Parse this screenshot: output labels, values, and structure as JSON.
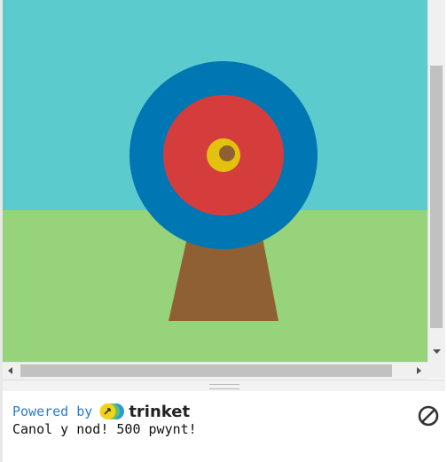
{
  "scene": {
    "sky_color": "#5ccbcd",
    "grass_color": "#97d37a",
    "stand_color": "#8f6033",
    "rings": [
      {
        "name": "outer-ring",
        "color": "#0077b3"
      },
      {
        "name": "middle-ring",
        "color": "#d53d3d"
      },
      {
        "name": "inner-ring",
        "color": "#e2c20f"
      },
      {
        "name": "bullseye",
        "color": "#8f6033"
      }
    ]
  },
  "scrollbars": {
    "vertical_down_icon": "arrow-down-icon",
    "horizontal_left_icon": "arrow-left-icon",
    "horizontal_right_icon": "arrow-right-icon"
  },
  "console": {
    "powered_by": "Powered by",
    "brand": "trinket",
    "output_line": "Canol y nod! 500 pwynt!",
    "stop_icon": "stop-icon"
  }
}
